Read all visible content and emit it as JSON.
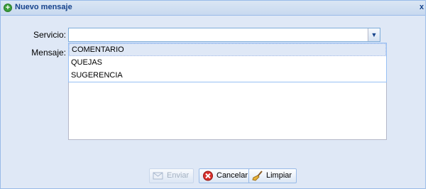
{
  "window": {
    "title": "Nuevo mensaje",
    "close_glyph": "x"
  },
  "form": {
    "servicio_label": "Servicio:",
    "servicio_value": "",
    "mensaje_label": "Mensaje:",
    "mensaje_value": ""
  },
  "dropdown": {
    "options": [
      "COMENTARIO",
      "QUEJAS",
      "SUGERENCIA"
    ],
    "highlighted_index": 0
  },
  "buttons": {
    "enviar": "Enviar",
    "cancelar": "Cancelar",
    "limpiar": "Limpiar"
  },
  "icons": {
    "title": "add-icon",
    "enviar": "envelope-send-icon",
    "cancelar": "cancel-icon",
    "limpiar": "broom-icon",
    "trigger": "chevron-down-icon"
  },
  "colors": {
    "panel_bg": "#dfe8f6",
    "title_color": "#15428b",
    "border": "#99bbe8"
  }
}
